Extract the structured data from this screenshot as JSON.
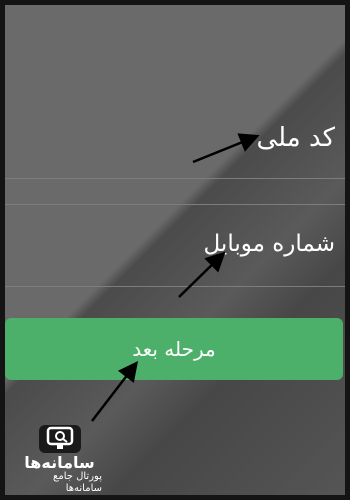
{
  "form": {
    "national_id_label": "کد ملی",
    "mobile_label": "شماره موبایل",
    "next_button_label": "مرحله بعد"
  },
  "logo": {
    "title": "سامانه‌ها",
    "subtitle": "پورتال جامع سامانه‌ها"
  },
  "colors": {
    "button": "#4caf6a",
    "arrow": "#000000"
  }
}
